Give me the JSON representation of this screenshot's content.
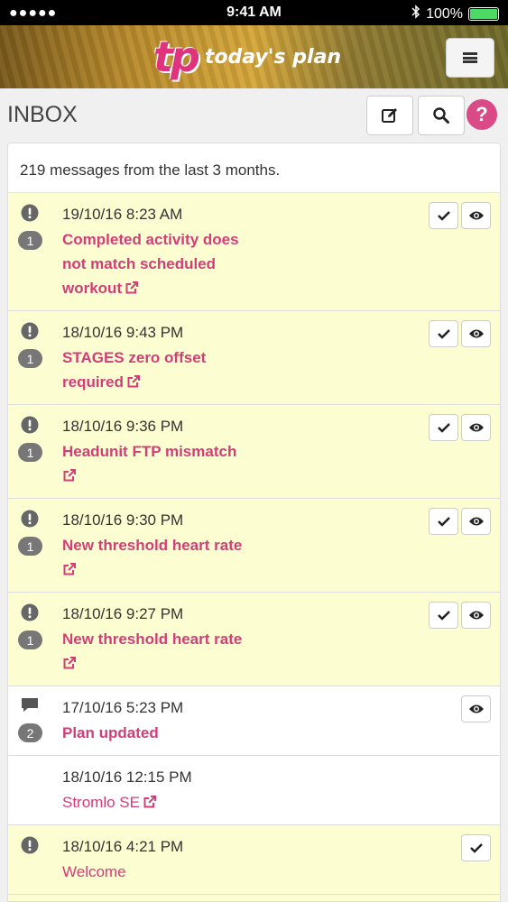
{
  "status": {
    "dots": "●●●●●",
    "time": "9:41 AM",
    "battery": "100%"
  },
  "brand": {
    "mark": "tp",
    "word": "today's plan"
  },
  "page": {
    "title": "INBOX"
  },
  "summary": "219 messages from the last 3 months.",
  "colors": {
    "accent": "#d23e78",
    "unread_bg": "#fdfdd2",
    "badge": "#777777"
  },
  "messages": [
    {
      "type": "alert",
      "count": "1",
      "date": "19/10/16 8:23 AM",
      "lines": [
        "Completed activity does",
        "not match scheduled",
        "workout"
      ],
      "actions": [
        "check",
        "eye"
      ]
    },
    {
      "type": "alert",
      "count": "1",
      "date": "18/10/16 9:43 PM",
      "lines": [
        "STAGES zero offset",
        "required"
      ],
      "actions": [
        "check",
        "eye"
      ]
    },
    {
      "type": "alert",
      "count": "1",
      "date": "18/10/16 9:36 PM",
      "lines": [
        "Headunit FTP mismatch",
        ""
      ],
      "actions": [
        "check",
        "eye"
      ]
    },
    {
      "type": "alert",
      "count": "1",
      "date": "18/10/16 9:30 PM",
      "lines": [
        "New threshold heart rate",
        ""
      ],
      "actions": [
        "check",
        "eye"
      ]
    },
    {
      "type": "alert",
      "count": "1",
      "date": "18/10/16 9:27 PM",
      "lines": [
        "New threshold heart rate",
        ""
      ],
      "actions": [
        "check",
        "eye"
      ]
    },
    {
      "type": "comment",
      "count": "2",
      "date": "17/10/16 5:23 PM",
      "lines": [
        "Plan updated"
      ],
      "actions": [
        "eye"
      ]
    },
    {
      "type": "plain",
      "count": "",
      "date": "18/10/16 12:15 PM",
      "lines": [
        "Stromlo SE"
      ],
      "actions": []
    },
    {
      "type": "alert",
      "count": "",
      "date": "18/10/16 4:21 PM",
      "lines": [
        "Welcome"
      ],
      "actions": [
        "check"
      ]
    }
  ]
}
